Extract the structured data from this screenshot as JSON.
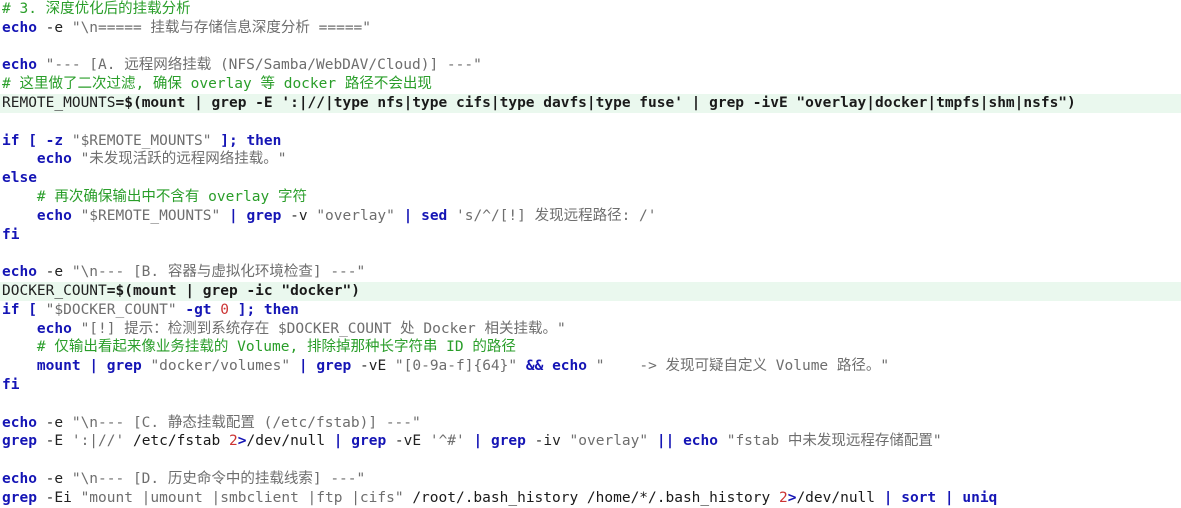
{
  "editor": {
    "lines": [
      {
        "hl": false,
        "tokens": [
          {
            "c": "c",
            "t": "# 3. 深度优化后的挂载分析"
          }
        ]
      },
      {
        "hl": false,
        "tokens": [
          {
            "c": "k",
            "t": "echo"
          },
          {
            "c": "n",
            "t": " -e "
          },
          {
            "c": "s",
            "t": "\"\\n===== 挂载与存储信息深度分析 =====\""
          }
        ]
      },
      {
        "hl": false,
        "tokens": []
      },
      {
        "hl": false,
        "tokens": [
          {
            "c": "k",
            "t": "echo"
          },
          {
            "c": "n",
            "t": " "
          },
          {
            "c": "s",
            "t": "\"--- [A. 远程网络挂载 (NFS/Samba/WebDAV/Cloud)] ---\""
          }
        ]
      },
      {
        "hl": false,
        "tokens": [
          {
            "c": "c",
            "t": "# 这里做了二次过滤, 确保 overlay 等 docker 路径不会出现"
          }
        ]
      },
      {
        "hl": true,
        "tokens": [
          {
            "c": "n",
            "t": "REMOTE_MOUNTS"
          },
          {
            "c": "b",
            "t": "=$(mount | grep -E ':|//|type nfs|type cifs|type davfs|type fuse' | grep -ivE \"overlay|docker|tmpfs|shm|nsfs\")"
          }
        ]
      },
      {
        "hl": false,
        "tokens": []
      },
      {
        "hl": false,
        "tokens": [
          {
            "c": "k",
            "t": "if [ -z "
          },
          {
            "c": "s",
            "t": "\"$REMOTE_MOUNTS\""
          },
          {
            "c": "k",
            "t": " ]; then"
          }
        ]
      },
      {
        "hl": false,
        "tokens": [
          {
            "c": "n",
            "t": "    "
          },
          {
            "c": "k",
            "t": "echo"
          },
          {
            "c": "n",
            "t": " "
          },
          {
            "c": "s",
            "t": "\"未发现活跃的远程网络挂载。\""
          }
        ]
      },
      {
        "hl": false,
        "tokens": [
          {
            "c": "k",
            "t": "else"
          }
        ]
      },
      {
        "hl": false,
        "tokens": [
          {
            "c": "n",
            "t": "    "
          },
          {
            "c": "c",
            "t": "# 再次确保输出中不含有 overlay 字符"
          }
        ]
      },
      {
        "hl": false,
        "tokens": [
          {
            "c": "n",
            "t": "    "
          },
          {
            "c": "k",
            "t": "echo"
          },
          {
            "c": "n",
            "t": " "
          },
          {
            "c": "s",
            "t": "\"$REMOTE_MOUNTS\""
          },
          {
            "c": "n",
            "t": " "
          },
          {
            "c": "o",
            "t": "|"
          },
          {
            "c": "n",
            "t": " "
          },
          {
            "c": "k",
            "t": "grep"
          },
          {
            "c": "n",
            "t": " -v "
          },
          {
            "c": "s",
            "t": "\"overlay\""
          },
          {
            "c": "n",
            "t": " "
          },
          {
            "c": "o",
            "t": "|"
          },
          {
            "c": "n",
            "t": " "
          },
          {
            "c": "k",
            "t": "sed"
          },
          {
            "c": "n",
            "t": " "
          },
          {
            "c": "s",
            "t": "'s/^/[!] 发现远程路径: /'"
          }
        ]
      },
      {
        "hl": false,
        "tokens": [
          {
            "c": "k",
            "t": "fi"
          }
        ]
      },
      {
        "hl": false,
        "tokens": []
      },
      {
        "hl": false,
        "tokens": [
          {
            "c": "k",
            "t": "echo"
          },
          {
            "c": "n",
            "t": " -e "
          },
          {
            "c": "s",
            "t": "\"\\n--- [B. 容器与虚拟化环境检查] ---\""
          }
        ]
      },
      {
        "hl": true,
        "tokens": [
          {
            "c": "n",
            "t": "DOCKER_COUNT"
          },
          {
            "c": "b",
            "t": "=$(mount | grep -ic \"docker\")"
          }
        ]
      },
      {
        "hl": false,
        "tokens": [
          {
            "c": "k",
            "t": "if [ "
          },
          {
            "c": "s",
            "t": "\"$DOCKER_COUNT\""
          },
          {
            "c": "k",
            "t": " -gt "
          },
          {
            "c": "nm",
            "t": "0"
          },
          {
            "c": "k",
            "t": " ]; then"
          }
        ]
      },
      {
        "hl": false,
        "tokens": [
          {
            "c": "n",
            "t": "    "
          },
          {
            "c": "k",
            "t": "echo"
          },
          {
            "c": "n",
            "t": " "
          },
          {
            "c": "s",
            "t": "\"[!] 提示：检测到系统存在 $DOCKER_COUNT 处 Docker 相关挂载。\""
          }
        ]
      },
      {
        "hl": false,
        "tokens": [
          {
            "c": "n",
            "t": "    "
          },
          {
            "c": "c",
            "t": "# 仅输出看起来像业务挂载的 Volume, 排除掉那种长字符串 ID 的路径"
          }
        ]
      },
      {
        "hl": false,
        "tokens": [
          {
            "c": "n",
            "t": "    "
          },
          {
            "c": "k",
            "t": "mount"
          },
          {
            "c": "n",
            "t": " "
          },
          {
            "c": "o",
            "t": "|"
          },
          {
            "c": "n",
            "t": " "
          },
          {
            "c": "k",
            "t": "grep"
          },
          {
            "c": "n",
            "t": " "
          },
          {
            "c": "s",
            "t": "\"docker/volumes\""
          },
          {
            "c": "n",
            "t": " "
          },
          {
            "c": "o",
            "t": "|"
          },
          {
            "c": "n",
            "t": " "
          },
          {
            "c": "k",
            "t": "grep"
          },
          {
            "c": "n",
            "t": " -vE "
          },
          {
            "c": "s",
            "t": "\"[0-9a-f]{64}\""
          },
          {
            "c": "n",
            "t": " "
          },
          {
            "c": "o",
            "t": "&&"
          },
          {
            "c": "n",
            "t": " "
          },
          {
            "c": "k",
            "t": "echo"
          },
          {
            "c": "n",
            "t": " "
          },
          {
            "c": "s",
            "t": "\"    -> 发现可疑自定义 Volume 路径。\""
          }
        ]
      },
      {
        "hl": false,
        "tokens": [
          {
            "c": "k",
            "t": "fi"
          }
        ]
      },
      {
        "hl": false,
        "tokens": []
      },
      {
        "hl": false,
        "tokens": [
          {
            "c": "k",
            "t": "echo"
          },
          {
            "c": "n",
            "t": " -e "
          },
          {
            "c": "s",
            "t": "\"\\n--- [C. 静态挂载配置 (/etc/fstab)] ---\""
          }
        ]
      },
      {
        "hl": false,
        "tokens": [
          {
            "c": "k",
            "t": "grep"
          },
          {
            "c": "n",
            "t": " -E "
          },
          {
            "c": "s",
            "t": "':|//'"
          },
          {
            "c": "n",
            "t": " "
          },
          {
            "c": "p",
            "t": "/etc/fstab"
          },
          {
            "c": "n",
            "t": " "
          },
          {
            "c": "nm",
            "t": "2"
          },
          {
            "c": "o",
            "t": ">"
          },
          {
            "c": "p",
            "t": "/dev/null"
          },
          {
            "c": "n",
            "t": " "
          },
          {
            "c": "o",
            "t": "|"
          },
          {
            "c": "n",
            "t": " "
          },
          {
            "c": "k",
            "t": "grep"
          },
          {
            "c": "n",
            "t": " -vE "
          },
          {
            "c": "s",
            "t": "'^#'"
          },
          {
            "c": "n",
            "t": " "
          },
          {
            "c": "o",
            "t": "|"
          },
          {
            "c": "n",
            "t": " "
          },
          {
            "c": "k",
            "t": "grep"
          },
          {
            "c": "n",
            "t": " -iv "
          },
          {
            "c": "s",
            "t": "\"overlay\""
          },
          {
            "c": "n",
            "t": " "
          },
          {
            "c": "o",
            "t": "||"
          },
          {
            "c": "n",
            "t": " "
          },
          {
            "c": "k",
            "t": "echo"
          },
          {
            "c": "n",
            "t": " "
          },
          {
            "c": "s",
            "t": "\"fstab 中未发现远程存储配置\""
          }
        ]
      },
      {
        "hl": false,
        "tokens": []
      },
      {
        "hl": false,
        "tokens": [
          {
            "c": "k",
            "t": "echo"
          },
          {
            "c": "n",
            "t": " -e "
          },
          {
            "c": "s",
            "t": "\"\\n--- [D. 历史命令中的挂载线索] ---\""
          }
        ]
      },
      {
        "hl": false,
        "tokens": [
          {
            "c": "k",
            "t": "grep"
          },
          {
            "c": "n",
            "t": " -Ei "
          },
          {
            "c": "s",
            "t": "\"mount |umount |smbclient |ftp |cifs\""
          },
          {
            "c": "n",
            "t": " "
          },
          {
            "c": "p",
            "t": "/root/.bash_history /home/*/.bash_history"
          },
          {
            "c": "n",
            "t": " "
          },
          {
            "c": "nm",
            "t": "2"
          },
          {
            "c": "o",
            "t": ">"
          },
          {
            "c": "p",
            "t": "/dev/null"
          },
          {
            "c": "n",
            "t": " "
          },
          {
            "c": "o",
            "t": "|"
          },
          {
            "c": "n",
            "t": " "
          },
          {
            "c": "k",
            "t": "sort"
          },
          {
            "c": "n",
            "t": " "
          },
          {
            "c": "o",
            "t": "|"
          },
          {
            "c": "n",
            "t": " "
          },
          {
            "c": "k",
            "t": "uniq"
          }
        ]
      }
    ]
  }
}
